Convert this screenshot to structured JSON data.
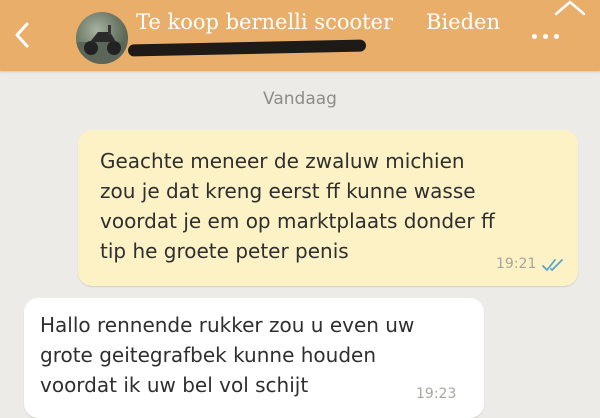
{
  "header": {
    "title": "Te koop bernelli scooter",
    "action_label": "Bieden",
    "colors": {
      "bar": "#e8ae6a",
      "text": "#ffffff"
    },
    "icons": {
      "back": "chevron-left-icon",
      "more": "more-dots-icon"
    }
  },
  "chat": {
    "date_label": "Vandaag",
    "messages": [
      {
        "direction": "outgoing",
        "text": "Geachte meneer de zwaluw michien\nzou je dat kreng eerst ff kunne wasse\nvoordat je em op marktplaats donder ff\ntip he groete peter penis",
        "time": "19:21",
        "status": "read"
      },
      {
        "direction": "incoming",
        "text": "Hallo rennende rukker zou u even uw\ngrote geitegrafbek kunne houden\nvoordat ik uw bel vol schijt",
        "time": "19:23"
      }
    ],
    "colors": {
      "outgoing": "#fdf1c6",
      "incoming": "#ffffff",
      "read_checks": "#5aa4c7"
    }
  }
}
